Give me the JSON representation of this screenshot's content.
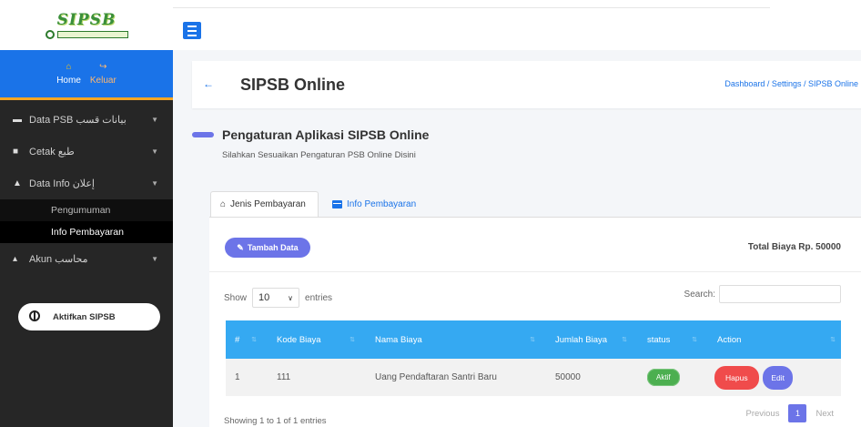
{
  "sidebar": {
    "logo_text": "SIPSB",
    "user_panel": {
      "home": "Home",
      "keluar": "Keluar"
    },
    "menu": [
      {
        "label": "Data PSB بيانات قسب",
        "icon": "car-icon"
      },
      {
        "label": "Cetak طبع",
        "icon": "book-icon"
      },
      {
        "label": "Data Info إعلان",
        "icon": "bell-icon"
      }
    ],
    "submenu": [
      "Pengumuman",
      "Info Pembayaran"
    ],
    "akun": "Akun محاسب",
    "aktifkan": "Aktifkan SIPSB"
  },
  "header": {
    "title": "SIPSB Online",
    "breadcrumb": "Dashboard  /  Settings  /  SIPSB Online"
  },
  "section": {
    "title": "Pengaturan Aplikasi SIPSB Online",
    "subtitle": "Silahkan Sesuaikan Pengaturan PSB Online Disini"
  },
  "tabs": [
    "Jenis Pembayaran",
    "Info Pembayaran"
  ],
  "toolbar": {
    "tambah": "Tambah Data",
    "total": "Total Biaya Rp. 50000"
  },
  "table_controls": {
    "show": "Show",
    "entries_value": "10",
    "entries": "entries",
    "search": "Search:"
  },
  "table": {
    "headers": [
      "#",
      "Kode Biaya",
      "Nama Biaya",
      "Jumlah Biaya",
      "status",
      "Action"
    ],
    "rows": [
      {
        "no": "1",
        "kode": "111",
        "nama": "Uang Pendaftaran Santri Baru",
        "jumlah": "50000",
        "status": "Aktif"
      }
    ],
    "actions": {
      "hapus": "Hapus",
      "edit": "Edit"
    }
  },
  "footer": {
    "showing": "Showing 1 to 1 of 1 entries",
    "previous": "Previous",
    "page": "1",
    "next": "Next"
  },
  "colors": {
    "sidebar_bg": "#262626",
    "primary_blue": "#1a73e8",
    "accent_purple": "#6c74e8",
    "table_header": "#35a9f2",
    "success": "#4caf50",
    "danger": "#f04b4b"
  }
}
